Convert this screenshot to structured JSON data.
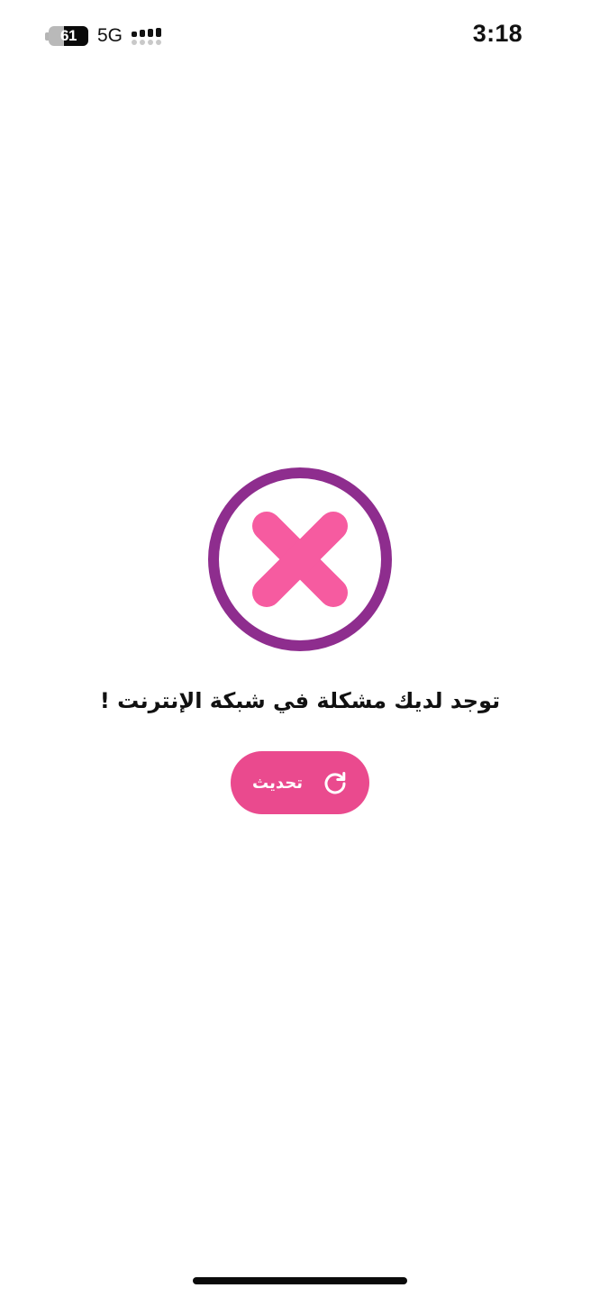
{
  "status_bar": {
    "battery_level": "61",
    "battery_percent": 61,
    "network": "5G",
    "signal_bars": 4,
    "time": "3:18"
  },
  "error": {
    "icon": "close-icon",
    "message": "توجد لديك مشكلة في شبكة الإنترنت !",
    "ring_color": "#8e2d8e",
    "cross_color": "#f65ba0"
  },
  "refresh_button": {
    "label": "تحديث",
    "icon": "refresh-icon",
    "color": "#ea4a8e"
  }
}
